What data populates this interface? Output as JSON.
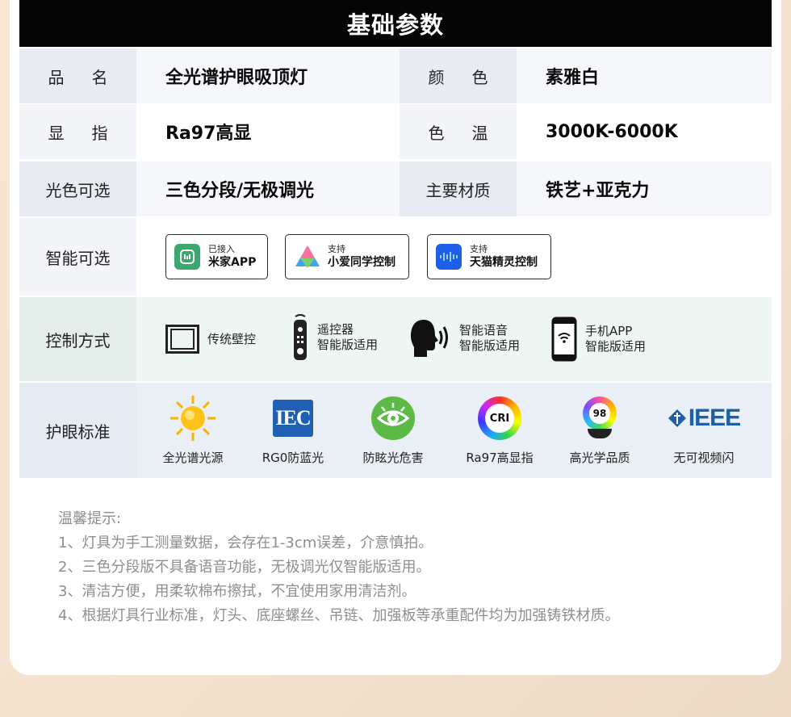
{
  "header": {
    "title": "基础参数"
  },
  "params": {
    "name_label": "品名",
    "name_value": "全光谱护眼吸顶灯",
    "color_label": "颜色",
    "color_value": "素雅白",
    "display_label": "显指",
    "display_value": "Ra97高显",
    "temp_label": "色温",
    "temp_value": "3000K-6000K",
    "light_label": "光色可选",
    "light_value": "三色分段/无极调光",
    "material_label": "主要材质",
    "material_value": "铁艺+亚克力"
  },
  "smart": {
    "label": "智能可选",
    "badges": [
      {
        "line1": "已接入",
        "line2": "米家APP",
        "icon": "mijia-icon",
        "color": "#3ca86e"
      },
      {
        "line1": "支持",
        "line2": "小爱同学控制",
        "icon": "xiaoai-icon",
        "color": "#2f7de1"
      },
      {
        "line1": "支持",
        "line2": "天猫精灵控制",
        "icon": "tmall-genie-icon",
        "color": "#1d5fe8"
      }
    ]
  },
  "control": {
    "label": "控制方式",
    "items": [
      {
        "line1": "传统壁控",
        "line2": "",
        "icon": "wall-switch-icon"
      },
      {
        "line1": "遥控器",
        "line2": "智能版适用",
        "icon": "remote-icon"
      },
      {
        "line1": "智能语音",
        "line2": "智能版适用",
        "icon": "voice-icon"
      },
      {
        "line1": "手机APP",
        "line2": "智能版适用",
        "icon": "phone-app-icon"
      }
    ]
  },
  "eye": {
    "label": "护眼标准",
    "items": [
      {
        "caption": "全光谱光源",
        "icon": "sun-icon"
      },
      {
        "caption": "RG0防蓝光",
        "icon": "iec-icon",
        "text": "IEC"
      },
      {
        "caption": "防眩光危害",
        "icon": "eye-icon"
      },
      {
        "caption": "Ra97高显指",
        "icon": "cri-icon",
        "text": "CRI"
      },
      {
        "caption": "高光学品质",
        "icon": "ra98-icon",
        "text": "98"
      },
      {
        "caption": "无可视频闪",
        "icon": "ieee-icon",
        "text": "IEEE"
      }
    ]
  },
  "notes": {
    "title": "温馨提示:",
    "lines": [
      "1、灯具为手工测量数据，会存在1-3cm误差，介意慎拍。",
      "2、三色分段版不具备语音功能，无极调光仅智能版适用。",
      "3、清洁方便，用柔软棉布擦拭，不宜使用家用清洁剂。",
      "4、根据灯具行业标准，灯头、底座螺丝、吊链、加强板等承重配件均为加强铸铁材质。"
    ]
  }
}
